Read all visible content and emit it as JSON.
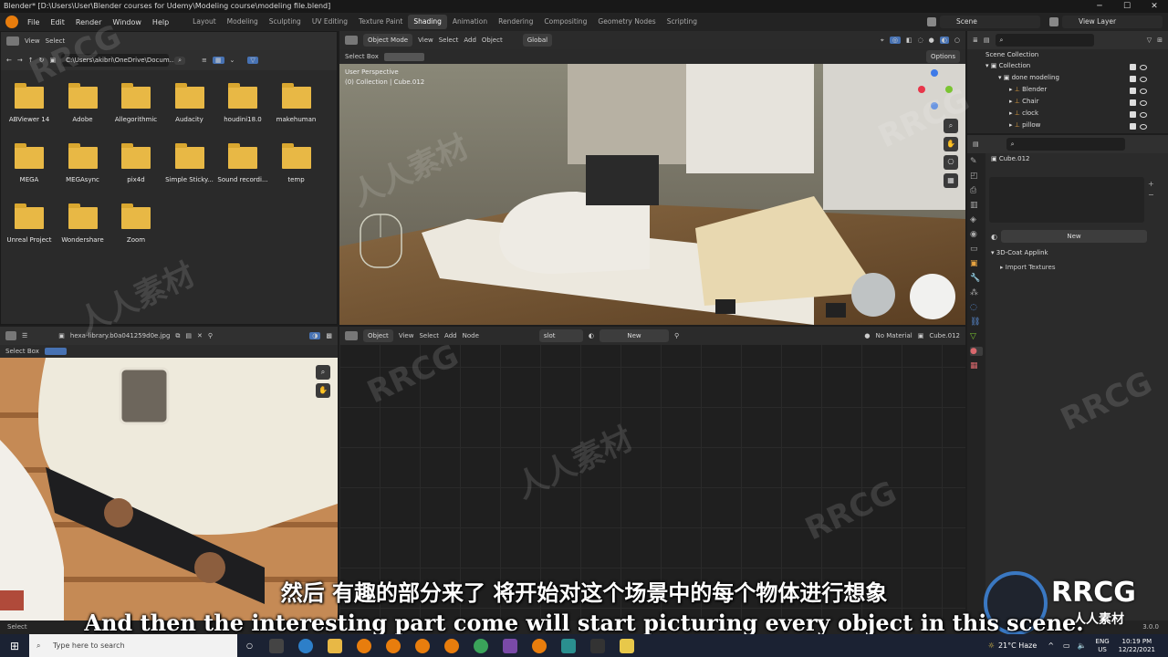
{
  "window": {
    "title": "Blender* [D:\\Users\\User\\Blender courses for Udemy\\Modeling course\\modeling file.blend]"
  },
  "menu": {
    "file": "File",
    "edit": "Edit",
    "render": "Render",
    "window": "Window",
    "help": "Help"
  },
  "workspaces": [
    "Layout",
    "Modeling",
    "Sculpting",
    "UV Editing",
    "Texture Paint",
    "Shading",
    "Animation",
    "Rendering",
    "Compositing",
    "Geometry Nodes",
    "Scripting"
  ],
  "active_workspace": "Shading",
  "scene": {
    "name": "Scene",
    "view_layer": "View Layer"
  },
  "file_browser": {
    "view": "View",
    "select": "Select",
    "path": "C:\\Users\\akibri\\OneDrive\\Docum...",
    "folders": [
      "ABViewer 14",
      "Adobe",
      "Allegorithmic",
      "Audacity",
      "houdini18.0",
      "makehuman",
      "MEGA",
      "MEGAsync",
      "pix4d",
      "Simple Sticky...",
      "Sound recordi...",
      "temp",
      "Unreal Project",
      "Wondershare",
      "Zoom"
    ]
  },
  "viewport": {
    "mode": "Object Mode",
    "view": "View",
    "select": "Select",
    "add": "Add",
    "object": "Object",
    "orientation": "Global",
    "select_box": "Select Box",
    "options": "Options",
    "perspective": "User Perspective",
    "collection_info": "(0) Collection | Cube.012"
  },
  "image_editor": {
    "filename": "hexa-library.b0a041259d0e.jpg",
    "select_box": "Select Box"
  },
  "node_editor": {
    "object": "Object",
    "view": "View",
    "select": "Select",
    "add": "Add",
    "node": "Node",
    "slot": "slot",
    "new_label": "New",
    "material": "No Material",
    "object_name": "Cube.012"
  },
  "outliner": {
    "scene_collection": "Scene Collection",
    "collection": "Collection",
    "items": [
      "done modeling",
      "Blender",
      "Chair",
      "clock",
      "pillow"
    ]
  },
  "properties": {
    "object_name": "Cube.012",
    "new_label": "New",
    "addon": "3D-Coat Applink",
    "import": "Import Textures"
  },
  "status": {
    "select": "Select",
    "version": "3.0.0"
  },
  "subtitles": {
    "zh": "然后 有趣的部分来了 将开始对这个场景中的每个物体进行想象",
    "en": "And then the interesting part come will start picturing every object in this scene."
  },
  "taskbar": {
    "search": "Type here to search",
    "weather": "21°C Haze",
    "lang": "ENG",
    "region": "US",
    "time": "10:19 PM",
    "date": "12/22/2021"
  },
  "watermark": {
    "brand": "RRCG",
    "cn": "人人素材"
  }
}
